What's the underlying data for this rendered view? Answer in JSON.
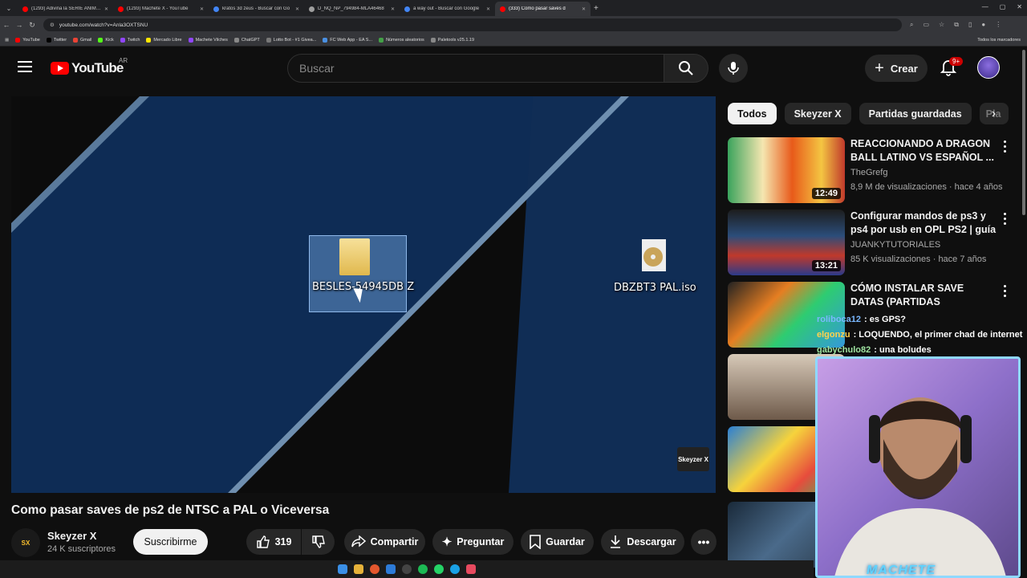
{
  "browser": {
    "tabs": [
      {
        "label": "(1293) Adivina la SERIE ANIMAD",
        "icon": "youtube-icon"
      },
      {
        "label": "(1293) Machete X - YouTube",
        "icon": "youtube-icon"
      },
      {
        "label": "kratos 3d zeus - Buscar con Go",
        "icon": "google-icon"
      },
      {
        "label": "D_NQ_NP_794984-MLA46468",
        "icon": "image-icon"
      },
      {
        "label": "a way out - Buscar con Google",
        "icon": "google-icon"
      },
      {
        "label": "(333) Como pasar saves d",
        "icon": "youtube-icon"
      }
    ],
    "url": "youtube.com/watch?v=Anla3OXTSNU",
    "bookmarks": [
      "YouTube",
      "Twitter",
      "Gmail",
      "Kick",
      "Twitch",
      "Mercado Libre",
      "Machete Vilches",
      "ChatGPT",
      "Lotto Bot - #1 Givea...",
      "FC Web App - EA S...",
      "Números aleatorios",
      "Paletools v25.1.19"
    ],
    "bookmarks_all": "Todos los marcadores"
  },
  "header": {
    "logo": "YouTube",
    "country": "AR",
    "search_placeholder": "Buscar",
    "create_label": "Crear",
    "notif_count": "9+"
  },
  "player": {
    "folder_label": "BESLES-54945DB Z",
    "iso_label": "DBZBT3 PAL.iso",
    "watermark": "Skeyzer X"
  },
  "video": {
    "title": "Como pasar saves de ps2 de NTSC a PAL o Viceversa",
    "channel": "Skeyzer X",
    "subscribers": "24 K suscriptores",
    "subscribe_label": "Suscribirme",
    "likes": "319",
    "share_label": "Compartir",
    "ask_label": "Preguntar",
    "save_label": "Guardar",
    "download_label": "Descargar"
  },
  "sidebar": {
    "chips": [
      "Todos",
      "Skeyzer X",
      "Partidas guardadas",
      "Pla"
    ],
    "recommendations": [
      {
        "title": "REACCIONANDO A DRAGON BALL LATINO VS ESPAÑOL ...",
        "channel": "TheGrefg",
        "meta": "8,9 M de visualizaciones · hace 4 años",
        "duration": "12:49"
      },
      {
        "title": "Configurar mandos de ps3 y ps4 por usb en OPL PS2 | guía ...",
        "channel": "JUANKYTUTORIALES",
        "meta": "85 K visualizaciones · hace 7 años",
        "duration": "13:21"
      },
      {
        "title": "CÓMO INSTALAR SAVE DATAS (PARTIDAS GUARDADAS) en l...",
        "channel": "",
        "meta": "",
        "duration": ""
      },
      {
        "title": "",
        "channel": "",
        "meta": "",
        "duration": ""
      },
      {
        "title": "",
        "channel": "",
        "meta": "",
        "duration": ""
      },
      {
        "title": "",
        "channel": "",
        "meta": "",
        "duration": ""
      }
    ]
  },
  "chat": [
    {
      "user": "roliboca12",
      "msg": ": es GPS?",
      "color": "#7ab8ff"
    },
    {
      "user": "elgonzu",
      "msg": ": LOQUENDO, el primer chad de internet",
      "color": "#ffd24d"
    },
    {
      "user": "gabychulo82",
      "msg": ": una boludes",
      "color": "#9fe3a0"
    }
  ],
  "stream": {
    "label": "MACHETE"
  }
}
